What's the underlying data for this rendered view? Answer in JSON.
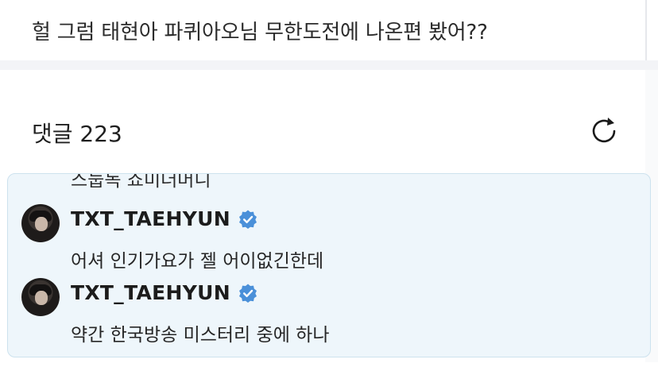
{
  "post": {
    "text": "헐 그럼 태현아 파퀴아오님 무한도전에 나온편 봤어??"
  },
  "comments_section": {
    "label": "댓글 223",
    "refresh_icon": "refresh-icon"
  },
  "thread": {
    "partial_text": "스눕독 쇼미더머니",
    "comments": [
      {
        "username": "TXT_TAEHYUN",
        "verified": true,
        "text": "어셔 인기가요가 젤 어이없긴한데"
      },
      {
        "username": "TXT_TAEHYUN",
        "verified": true,
        "text": "약간 한국방송 미스터리 중에 하나"
      }
    ]
  },
  "colors": {
    "panel_bg": "#eef6fb",
    "panel_border": "#cde2ee",
    "verified_blue": "#4a90d9"
  }
}
